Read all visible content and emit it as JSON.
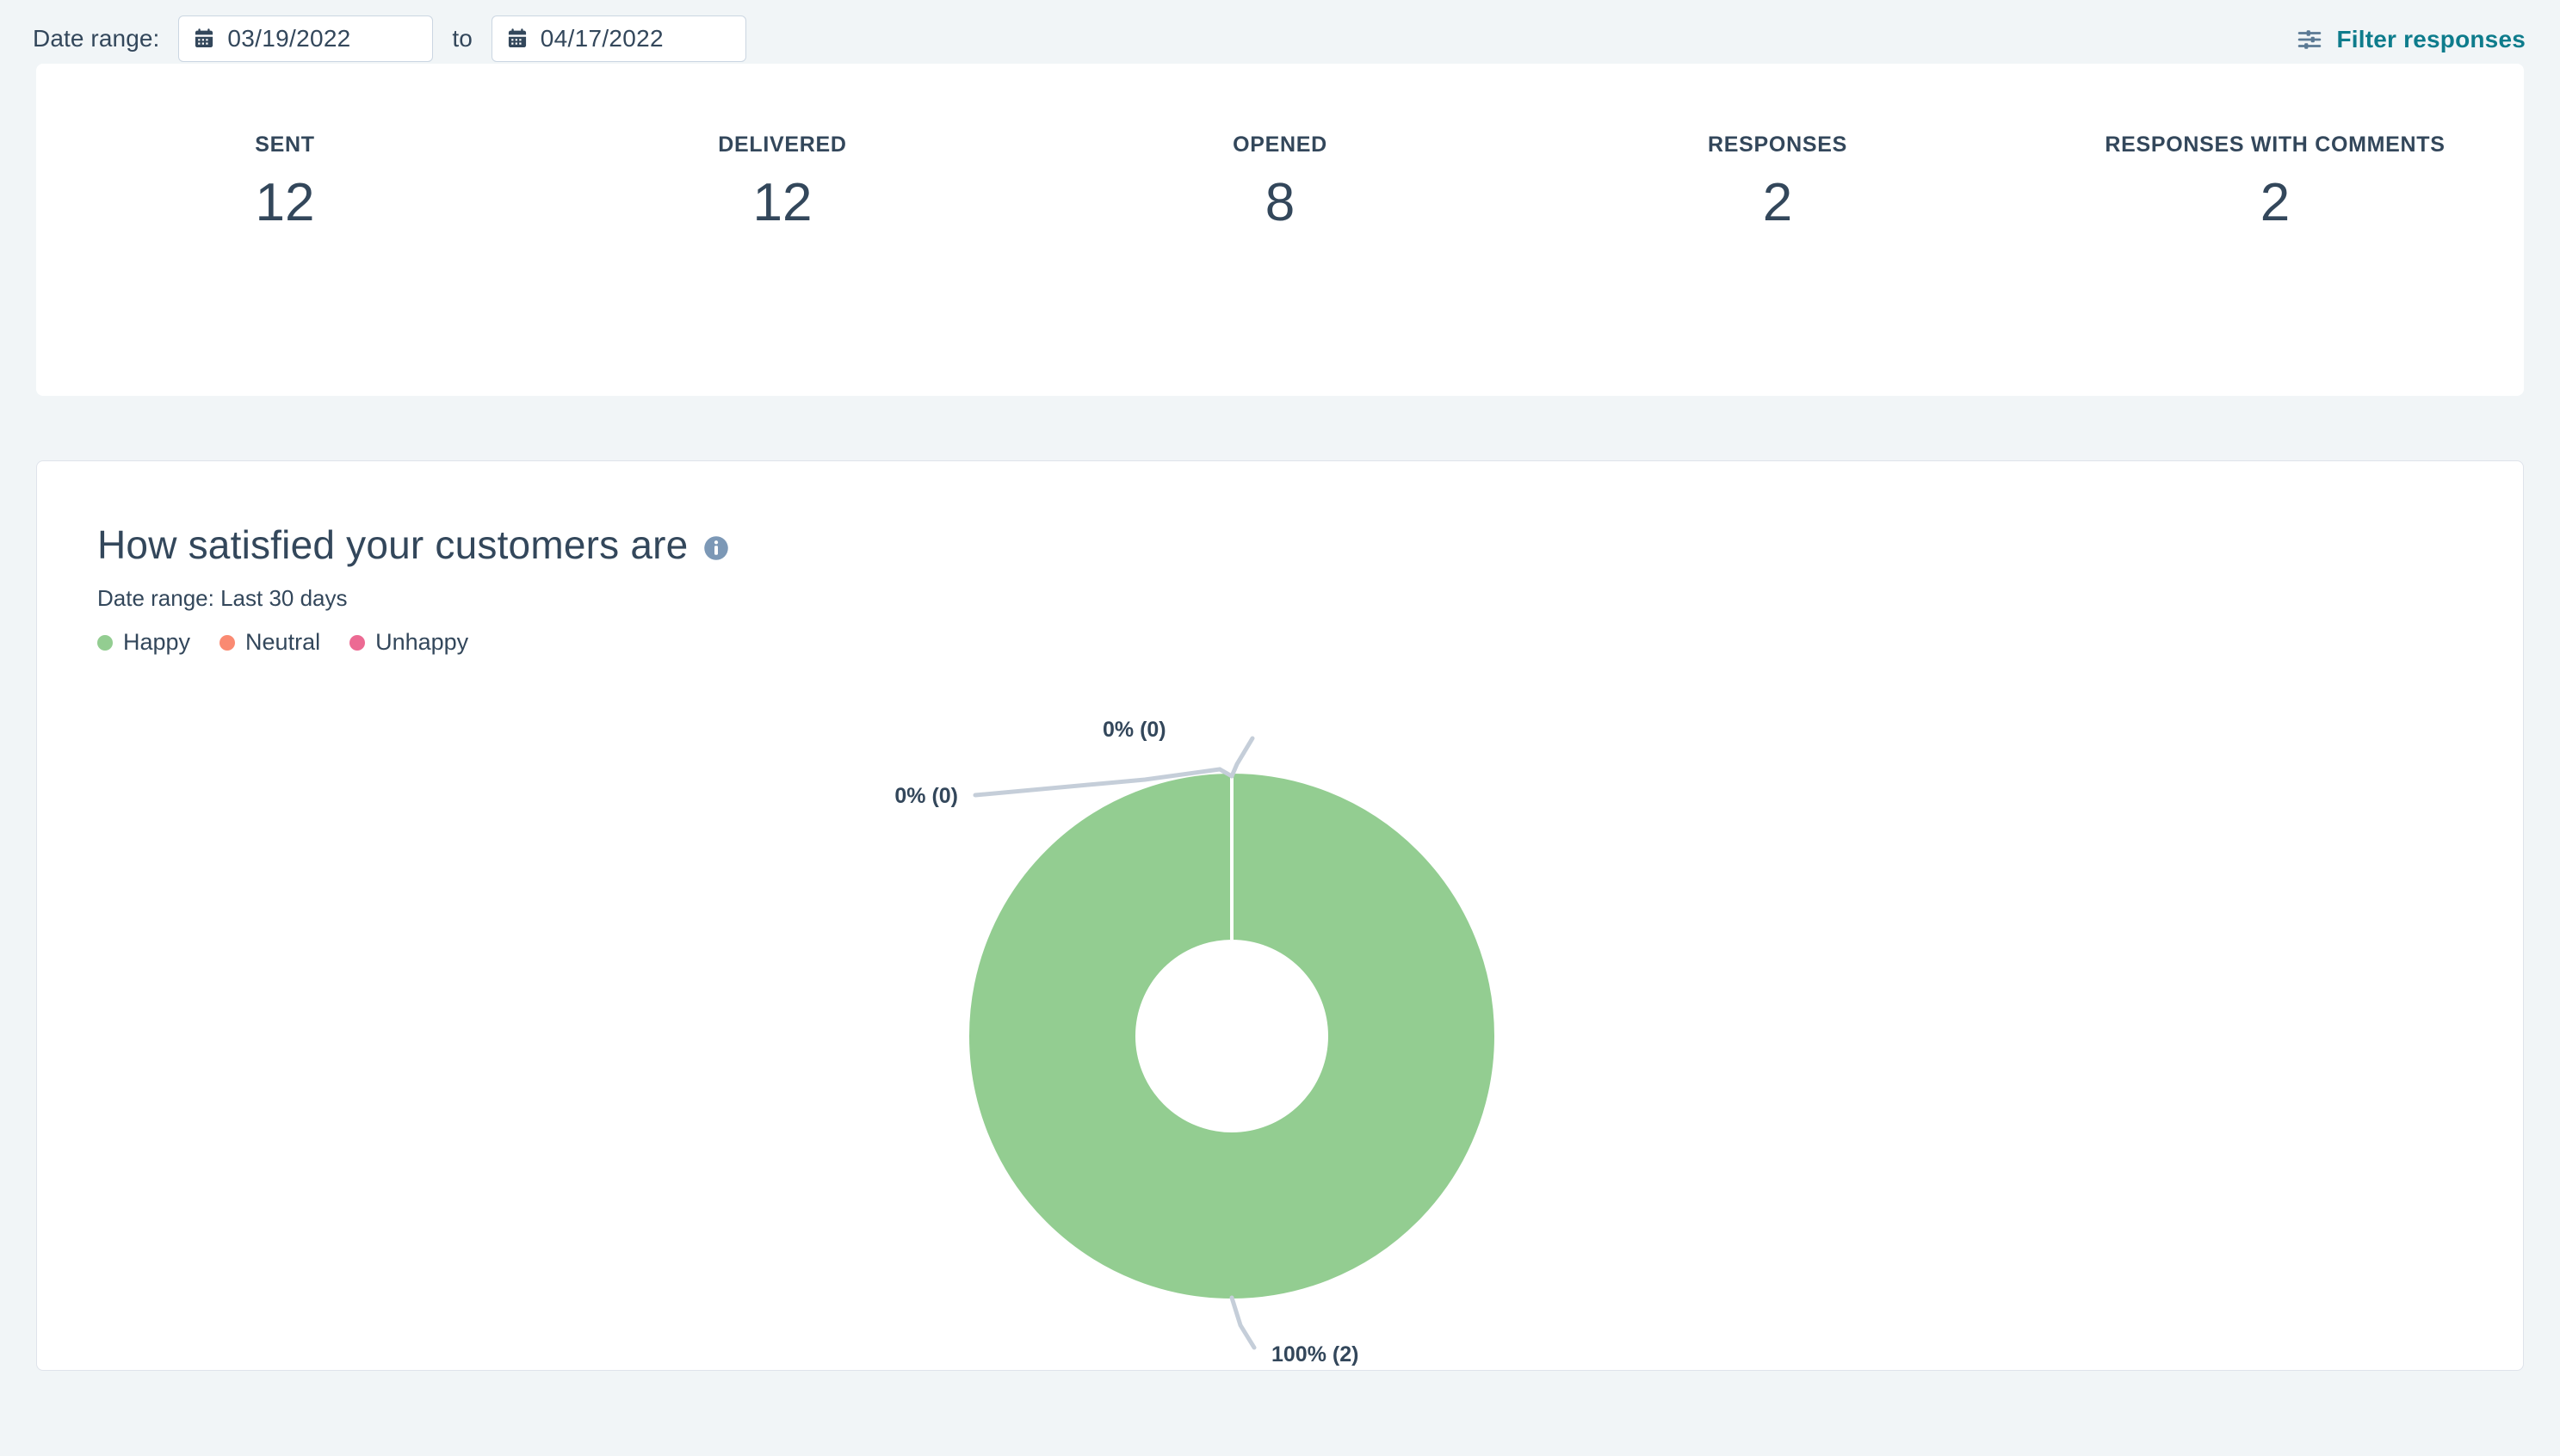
{
  "toolbar": {
    "date_range_label": "Date range:",
    "start_date": "03/19/2022",
    "end_date": "04/17/2022",
    "separator": "to",
    "calendar_icon": "calendar-icon",
    "filter_label": "Filter responses",
    "filter_icon": "sliders-icon",
    "filter_color": "#0e7c8c"
  },
  "stats": {
    "items": [
      {
        "label": "SENT",
        "value": "12"
      },
      {
        "label": "DELIVERED",
        "value": "12"
      },
      {
        "label": "OPENED",
        "value": "8"
      },
      {
        "label": "RESPONSES",
        "value": "2"
      },
      {
        "label": "RESPONSES WITH COMMENTS",
        "value": "2"
      }
    ]
  },
  "chart_card": {
    "title": "How satisfied your customers are",
    "info_icon": "info-icon",
    "subtitle": "Date range: Last 30 days",
    "legend": [
      {
        "label": "Happy",
        "color": "#93cd91"
      },
      {
        "label": "Neutral",
        "color": "#fa8a72"
      },
      {
        "label": "Unhappy",
        "color": "#ec6a93"
      }
    ]
  },
  "chart_data": {
    "type": "pie",
    "variant": "donut",
    "title": "How satisfied your customers are",
    "subtitle": "Date range: Last 30 days",
    "categories": [
      "Happy",
      "Neutral",
      "Unhappy"
    ],
    "values": [
      2,
      0,
      0
    ],
    "percentages": [
      100,
      0,
      0
    ],
    "colors": [
      "#93cd91",
      "#fa8a72",
      "#ec6a93"
    ],
    "data_labels": [
      "100% (2)",
      "0% (0)",
      "0% (0)"
    ],
    "label_happy": "100% (2)",
    "label_neutral": "0% (0)",
    "label_unhappy": "0% (0)",
    "total_responses": 2,
    "legend_position": "top-left",
    "grid": false,
    "xlabel": "",
    "ylabel": ""
  }
}
